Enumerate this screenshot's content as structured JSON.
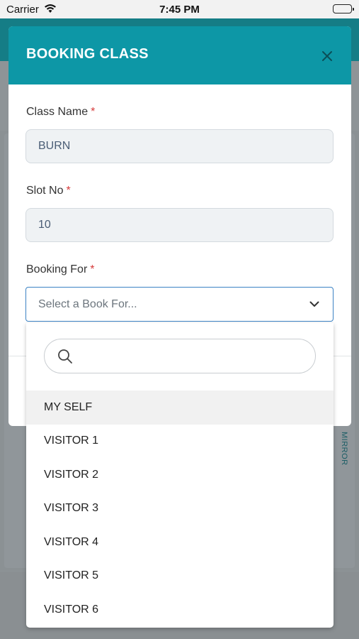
{
  "status_bar": {
    "carrier": "Carrier",
    "time": "7:45 PM"
  },
  "background": {
    "mirror_label": "MIRROR"
  },
  "modal": {
    "title": "BOOKING CLASS",
    "fields": {
      "class_name": {
        "label": "Class Name",
        "required_mark": "*",
        "value": "BURN"
      },
      "slot_no": {
        "label": "Slot No",
        "required_mark": "*",
        "value": "10"
      },
      "booking_for": {
        "label": "Booking For",
        "required_mark": "*",
        "placeholder": "Select a Book For..."
      }
    }
  },
  "dropdown": {
    "search_placeholder": "",
    "options": [
      {
        "label": "MY SELF",
        "highlighted": true
      },
      {
        "label": "VISITOR 1"
      },
      {
        "label": "VISITOR 2"
      },
      {
        "label": "VISITOR 3"
      },
      {
        "label": "VISITOR 4"
      },
      {
        "label": "VISITOR 5"
      },
      {
        "label": "VISITOR 6"
      }
    ]
  },
  "colors": {
    "header_teal": "#0d97a6",
    "focus_blue": "#3b82c4",
    "required_red": "#d63b3b"
  },
  "icons": [
    "wifi-icon",
    "battery-icon",
    "close-icon",
    "chevron-down-icon",
    "search-icon"
  ]
}
